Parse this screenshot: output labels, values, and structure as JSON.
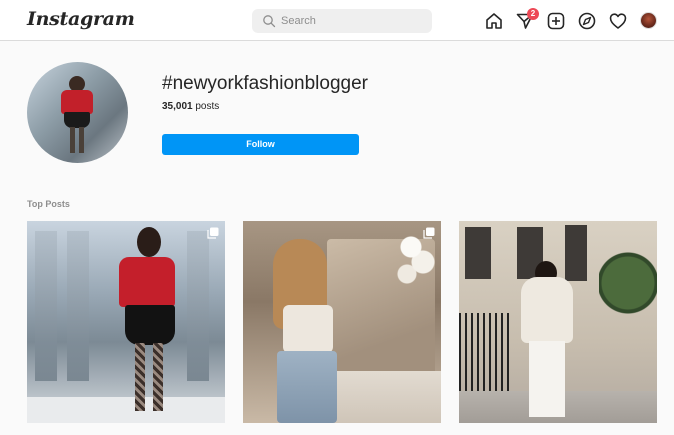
{
  "header": {
    "logo": "Instagram",
    "search_placeholder": "Search",
    "notification_badge": "2",
    "icons": [
      "home-icon",
      "direct-messages-icon",
      "new-post-icon",
      "explore-icon",
      "activity-heart-icon",
      "profile-avatar"
    ]
  },
  "hashtag": {
    "title": "#newyorkfashionblogger",
    "posts_count": "35,001",
    "posts_label": "posts",
    "follow_label": "Follow"
  },
  "section": {
    "top_posts_label": "Top Posts"
  },
  "posts": [
    {
      "type": "multiple-images"
    },
    {
      "type": "multiple-images"
    },
    {
      "type": "single-image"
    }
  ],
  "colors": {
    "accent": "#0095f6",
    "badge": "#ed4956",
    "background": "#fafafa"
  }
}
